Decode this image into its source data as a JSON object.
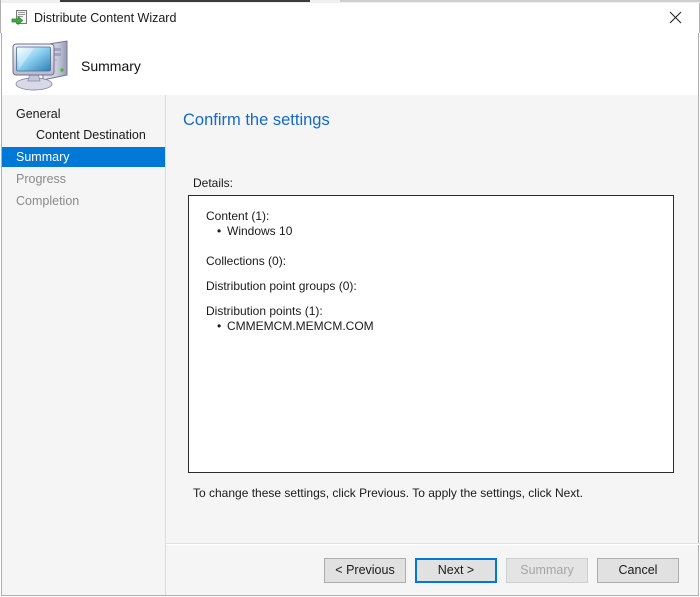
{
  "window": {
    "title": "Distribute Content Wizard",
    "title_icon": "distribute-content-icon",
    "close_label": "✕"
  },
  "banner": {
    "title": "Summary",
    "icon": "computer-icon"
  },
  "sidebar": {
    "items": [
      {
        "label": "General",
        "state": "normal",
        "indent": false
      },
      {
        "label": "Content Destination",
        "state": "normal",
        "indent": true
      },
      {
        "label": "Summary",
        "state": "active",
        "indent": false
      },
      {
        "label": "Progress",
        "state": "dim",
        "indent": false
      },
      {
        "label": "Completion",
        "state": "dim",
        "indent": false
      }
    ]
  },
  "content": {
    "heading": "Confirm the settings",
    "details_label": "Details:",
    "details": [
      {
        "title": "Content (1):",
        "items": [
          "Windows 10"
        ]
      },
      {
        "title": "Collections (0):",
        "items": []
      },
      {
        "title": "Distribution point groups (0):",
        "items": []
      },
      {
        "title": "Distribution points (1):",
        "items": [
          "CMMEMCM.MEMCM.COM"
        ]
      }
    ],
    "footnote": "To change these settings, click Previous. To apply the settings, click Next."
  },
  "buttons": {
    "previous": "< Previous",
    "next": "Next >",
    "summary": "Summary",
    "cancel": "Cancel"
  },
  "colors": {
    "accent": "#0078d7",
    "heading": "#1569c7",
    "body_bg": "#f5f5f5",
    "panel_bg": "#ffffff"
  }
}
